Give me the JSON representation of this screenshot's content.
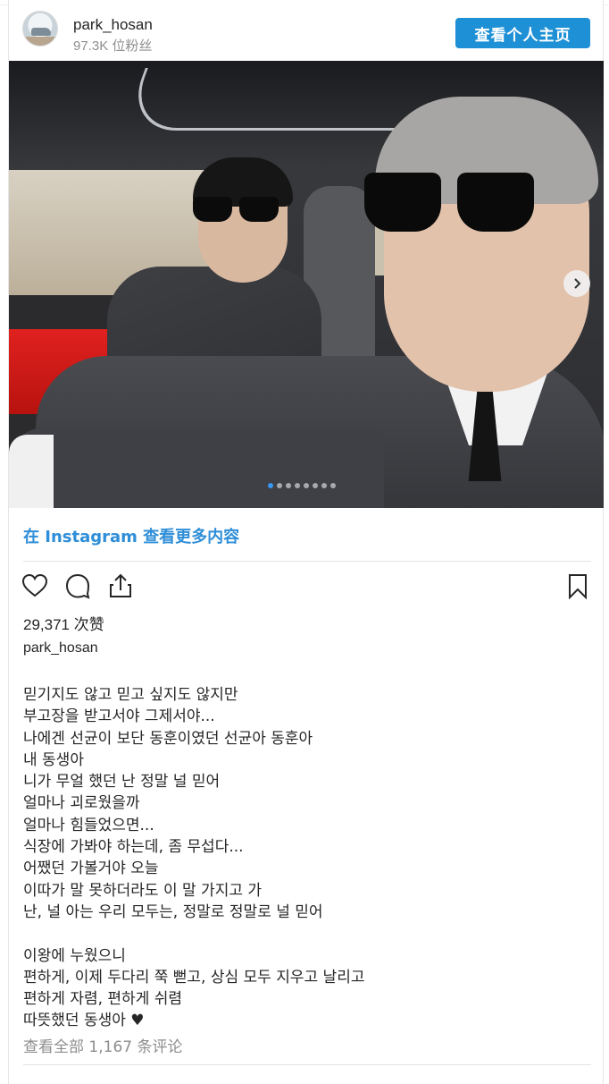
{
  "header": {
    "username": "park_hosan",
    "followers": "97.3K 位粉丝",
    "profile_button": "查看个人主页"
  },
  "carousel": {
    "slide_count": 8,
    "active_index": 0
  },
  "instagram_link": "在 Instagram 查看更多内容",
  "actions": {
    "like_icon": "heart-icon",
    "comment_icon": "comment-icon",
    "share_icon": "share-icon",
    "save_icon": "bookmark-icon"
  },
  "likes": "29,371 次赞",
  "caption_user": "park_hosan",
  "caption_lines": [
    "믿기지도 않고 믿고 싶지도 않지만",
    "부고장을 받고서야 그제서야...",
    "나에겐 선균이 보단 동훈이였던 선균아 동훈아",
    "내 동생아",
    "니가 무얼 했던 난 정말 널 믿어",
    "얼마나 괴로웠을까",
    "얼마나 힘들었으면...",
    "식장에 가봐야 하는데, 좀 무섭다...",
    "어쨌던 가볼거야 오늘",
    "이따가 말 못하더라도 이 말 가지고 가",
    "난, 널 아는 우리 모두는, 정말로 정말로 널 믿어",
    "",
    "이왕에 누웠으니",
    "편하게, 이제 두다리 쭉 뻗고, 상심 모두 지우고 날리고",
    "편하게 자렴, 편하게 쉬렴",
    "따뜻했던 동생아 ♥"
  ],
  "comments_link": "查看全部 1,167 条评论",
  "colors": {
    "accent": "#1e90d6",
    "link": "#2e8ed8",
    "muted": "#8e8e8e"
  }
}
